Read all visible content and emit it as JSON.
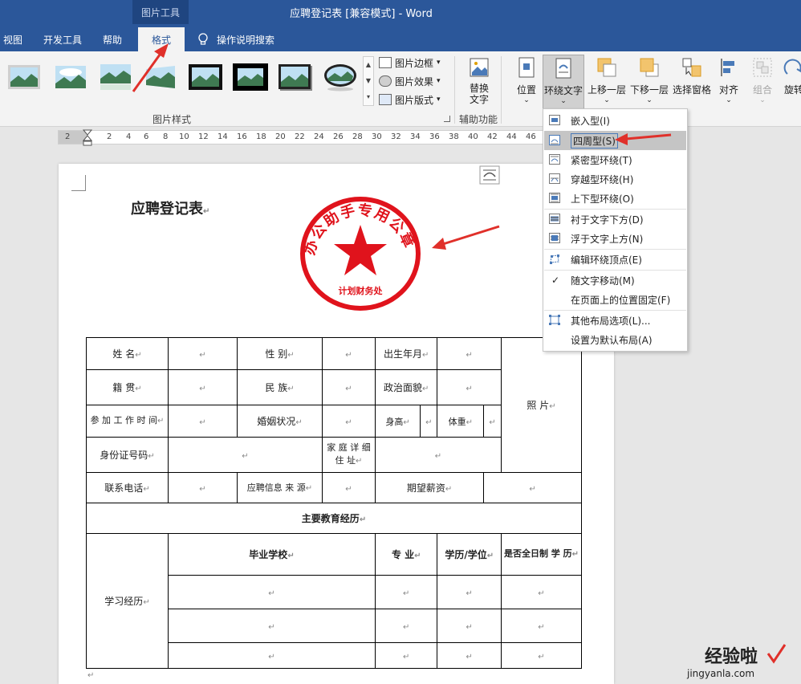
{
  "titlebar": {
    "context_tab": "图片工具",
    "doc_title": "应聘登记表 [兼容模式] - Word",
    "tabs": [
      "视图",
      "开发工具",
      "帮助",
      "格式"
    ],
    "search_label": "操作说明搜索"
  },
  "ribbon": {
    "picture_styles_label": "图片样式",
    "accessibility_label": "辅助功能",
    "border_label": "图片边框",
    "effects_label": "图片效果",
    "layout_label": "图片版式",
    "alt_text_label": "替换文字",
    "buttons": [
      "位置",
      "环绕文字",
      "上移一层",
      "下移一层",
      "选择窗格",
      "对齐",
      "组合",
      "旋转"
    ]
  },
  "ruler": {
    "ticks": [
      "2",
      "2",
      "4",
      "6",
      "8",
      "10",
      "12",
      "14",
      "16",
      "18",
      "20",
      "22",
      "24",
      "26",
      "28",
      "30",
      "32",
      "34",
      "36",
      "38",
      "40",
      "42",
      "44",
      "46"
    ]
  },
  "document": {
    "heading": "应聘登记表",
    "seal": {
      "arc_text": "办公助手专用公章",
      "bottom_text": "计划财务处",
      "color": "#e0131c"
    },
    "table": {
      "row1": [
        "姓 名",
        "性 别",
        "出生年月"
      ],
      "row2": [
        "籍 贯",
        "民 族",
        "政治面貌"
      ],
      "photo": "照 片",
      "row3": [
        "参 加 工 作 时 间",
        "婚姻状况",
        "身高",
        "体重"
      ],
      "row4": [
        "身份证号码",
        "家 庭 详 细 住 址"
      ],
      "row5": [
        "联系电话",
        "应聘信息 来 源",
        "期望薪资"
      ],
      "section": "主要教育经历",
      "headers": [
        "毕业学校",
        "专 业",
        "学历/学位",
        "是否全日制 学 历"
      ],
      "row_label": "学习经历"
    },
    "para_mark": "↵"
  },
  "wrap_menu": {
    "items": [
      {
        "label": "嵌入型(I)",
        "icon": "inline-icon"
      },
      {
        "label": "四周型(S)",
        "icon": "square-wrap-icon",
        "highlighted": true
      },
      {
        "label": "紧密型环绕(T)",
        "icon": "tight-wrap-icon"
      },
      {
        "label": "穿越型环绕(H)",
        "icon": "through-wrap-icon"
      },
      {
        "label": "上下型环绕(O)",
        "icon": "top-bottom-icon"
      },
      {
        "label": "衬于文字下方(D)",
        "icon": "behind-text-icon"
      },
      {
        "label": "浮于文字上方(N)",
        "icon": "in-front-icon"
      },
      {
        "label": "编辑环绕顶点(E)",
        "icon": "edit-points-icon"
      },
      {
        "label": "随文字移动(M)",
        "icon": "check-icon",
        "checked": true
      },
      {
        "label": "在页面上的位置固定(F)",
        "icon": ""
      },
      {
        "label": "其他布局选项(L)...",
        "icon": "layout-options-icon"
      },
      {
        "label": "设置为默认布局(A)",
        "icon": ""
      }
    ]
  },
  "watermark": {
    "text": "经验啦",
    "url": "jingyanla.com"
  },
  "colors": {
    "word_blue": "#2b579a",
    "annotation_red": "#e0302a",
    "menu_highlight": "#c5c5c5"
  }
}
